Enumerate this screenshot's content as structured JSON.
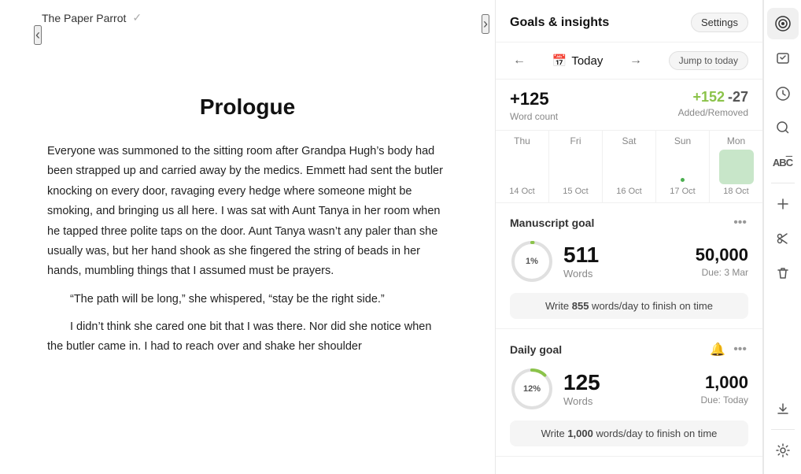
{
  "doc": {
    "title": "The Paper Parrot",
    "check_icon": "✓",
    "chapter": "Prologue",
    "paragraphs": [
      "Everyone was summoned to the sitting room after Grandpa Hugh’s body had been strapped up and carried away by the medics. Emmett had sent the butler knocking on every door, ravaging every hedge where someone might be smoking, and bringing us all here. I was sat with Aunt Tanya in her room when he tapped three polite taps on the door. Aunt Tanya wasn’t any paler than she usually was, but her hand shook as she fingered the string of beads in her hands, mumbling things that I assumed must be prayers.",
      "“The path will be long,” she whispered, “stay be the right side.”",
      "I didn’t think she cared one bit that I was there. Nor did she notice when the butler came in. I had to reach over and shake her shoulder"
    ]
  },
  "goals_panel": {
    "title": "Goals & insights",
    "settings_btn": "Settings",
    "date_nav": {
      "prev_arrow": "←",
      "next_arrow": "→",
      "current": "Today",
      "jump_today": "Jump to today",
      "calendar_icon": "📅"
    },
    "word_summary": {
      "count": "+125",
      "count_label": "Word count",
      "added": "+152",
      "removed": "-27",
      "added_removed_label": "Added/Removed"
    },
    "calendar": [
      {
        "day": "Thu",
        "date": "14 Oct",
        "active": false,
        "dot": false
      },
      {
        "day": "Fri",
        "date": "15 Oct",
        "active": false,
        "dot": false
      },
      {
        "day": "Sat",
        "date": "16 Oct",
        "active": false,
        "dot": false
      },
      {
        "day": "Sun",
        "date": "17 Oct",
        "active": false,
        "dot": true
      },
      {
        "day": "Mon",
        "date": "18 Oct",
        "active": true,
        "dot": false
      }
    ],
    "manuscript_goal": {
      "title": "Manuscript goal",
      "percent": "1%",
      "percent_value": 1,
      "words": "511",
      "words_label": "Words",
      "target": "50,000",
      "due": "Due: 3 Mar",
      "cta": "Write ",
      "cta_bold": "855",
      "cta_end": " words/day to finish on time",
      "color": "#8bc34a"
    },
    "daily_goal": {
      "title": "Daily goal",
      "percent": "12%",
      "percent_value": 12,
      "words": "125",
      "words_label": "Words",
      "target": "1,000",
      "due": "Due: Today",
      "cta": "Write ",
      "cta_bold": "1,000",
      "cta_end": " words/day to finish on time",
      "color": "#8bc34a",
      "bell_icon": "🔔"
    }
  },
  "sidebar_icons": [
    {
      "name": "target-icon",
      "symbol": "⊙",
      "active": true
    },
    {
      "name": "check-list-icon",
      "symbol": "✓",
      "active": false
    },
    {
      "name": "clock-icon",
      "symbol": "⏰",
      "active": false
    },
    {
      "name": "search-icon",
      "symbol": "🔍",
      "active": false
    },
    {
      "name": "spellcheck-icon",
      "symbol": "AB̄",
      "active": false
    },
    {
      "name": "plus-icon",
      "symbol": "+",
      "active": false
    },
    {
      "name": "scissors-icon",
      "symbol": "✂",
      "active": false
    },
    {
      "name": "trash-icon",
      "symbol": "🗑",
      "active": false
    },
    {
      "name": "download-icon",
      "symbol": "↓",
      "active": false
    },
    {
      "name": "settings-icon",
      "symbol": "⚙",
      "active": false
    }
  ]
}
